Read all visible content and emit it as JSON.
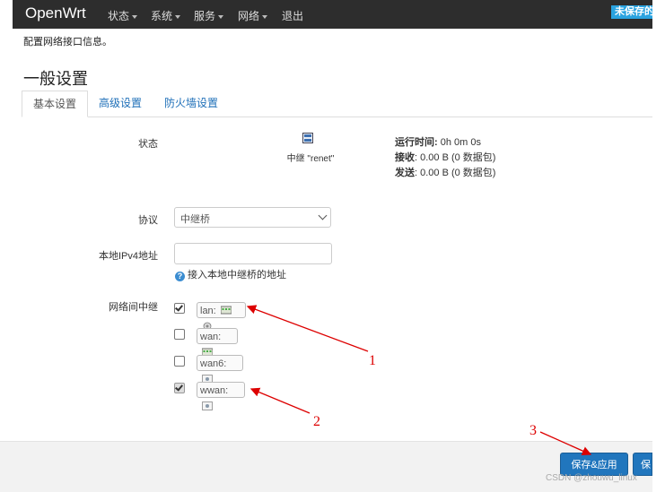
{
  "navbar": {
    "brand": "OpenWrt",
    "menus": [
      "状态",
      "系统",
      "服务",
      "网络"
    ],
    "logout": "退出",
    "unsaved_badge": "未保存的"
  },
  "page": {
    "description": "配置网络接口信息。",
    "section_title": "一般设置"
  },
  "tabs": [
    {
      "label": "基本设置",
      "active": true
    },
    {
      "label": "高级设置",
      "active": false
    },
    {
      "label": "防火墙设置",
      "active": false
    }
  ],
  "status": {
    "label": "状态",
    "device_name": "中继 \"renet\"",
    "uptime_label": "运行时间:",
    "uptime_value": " 0h 0m 0s",
    "rx_label": "接收",
    "rx_value": ": 0.00 B (0 数据包)",
    "tx_label": "发送",
    "tx_value": ": 0.00 B (0 数据包)"
  },
  "protocol": {
    "label": "协议",
    "value": "中继桥"
  },
  "ipv4": {
    "label": "本地IPv4地址",
    "value": "",
    "help": "接入本地中继桥的地址"
  },
  "relay": {
    "label": "网络间中继",
    "interfaces": [
      {
        "name": "lan:",
        "checked": true,
        "disabled": false
      },
      {
        "name": "wan:",
        "checked": false,
        "disabled": false
      },
      {
        "name": "wan6:",
        "checked": false,
        "disabled": false
      },
      {
        "name": "wwan:",
        "checked": true,
        "disabled": true
      }
    ]
  },
  "footer": {
    "save_apply": "保存&应用",
    "save_partial": "保"
  },
  "annotations": [
    "1",
    "2",
    "3"
  ],
  "watermark": "CSDN @zhouwu_linux",
  "colors": {
    "navbar": "#2d2d2d",
    "accent": "#2176bd",
    "annotation": "#dd0000"
  }
}
